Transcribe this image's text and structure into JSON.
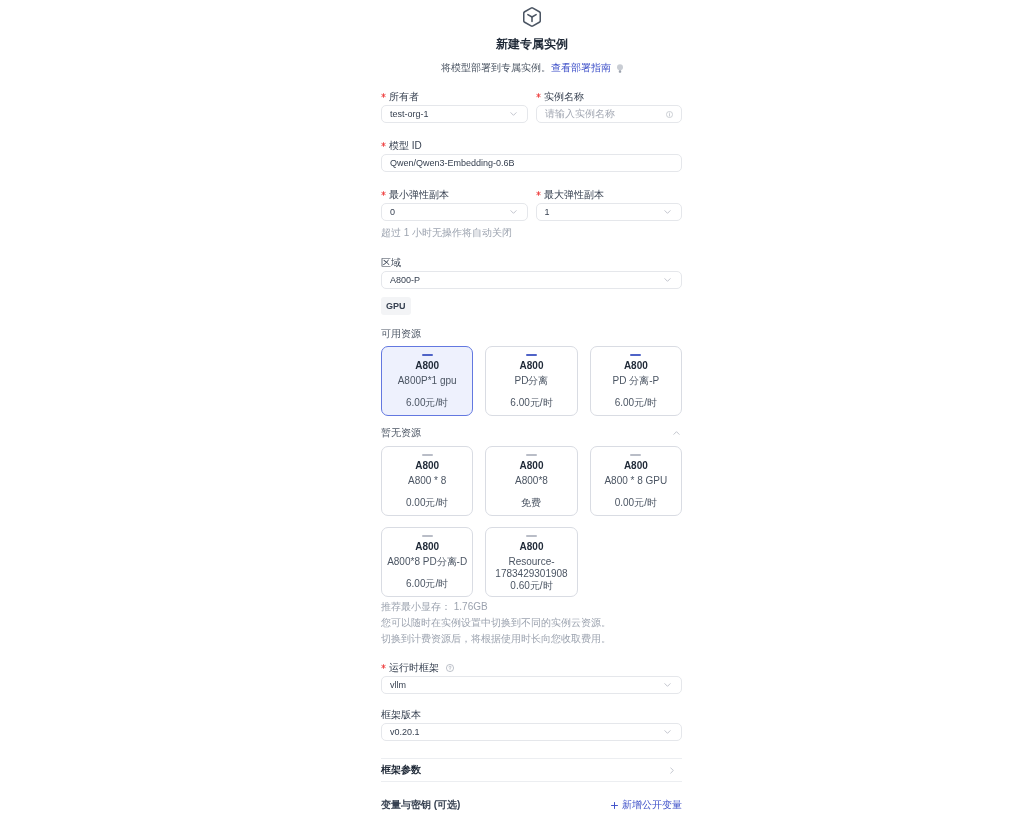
{
  "header": {
    "title": "新建专属实例",
    "subtitle": "将模型部署到专属实例。",
    "guide_link": "查看部署指南"
  },
  "owner": {
    "label": "所有者",
    "required": true,
    "kind": "select",
    "value": "test-org-1"
  },
  "instance_name": {
    "label": "实例名称",
    "required": true,
    "kind": "input",
    "placeholder": "请输入实例名称"
  },
  "model_id": {
    "label": "模型 ID",
    "required": true,
    "kind": "input",
    "value": "Qwen/Qwen3-Embedding-0.6B"
  },
  "min_replicas": {
    "label": "最小弹性副本",
    "required": true,
    "kind": "select",
    "value": "0"
  },
  "max_replicas": {
    "label": "最大弹性副本",
    "required": true,
    "kind": "select",
    "value": "1"
  },
  "replica_hint": "超过 1 小时无操作将自动关闭",
  "region": {
    "label": "区域",
    "required": false,
    "kind": "select",
    "value": "A800-P"
  },
  "resource_tabs": [
    {
      "label": "GPU",
      "selected": true
    }
  ],
  "available_resources": {
    "title": "可用资源",
    "cards": [
      {
        "title": "A800",
        "name": "A800P*1 gpu",
        "price": "6.00元/时",
        "selected": true,
        "disabled": false
      },
      {
        "title": "A800",
        "name": "PD分离",
        "price": "6.00元/时",
        "selected": false,
        "disabled": false
      },
      {
        "title": "A800",
        "name": "PD 分离-P",
        "price": "6.00元/时",
        "selected": false,
        "disabled": false
      }
    ]
  },
  "unavailable_resources": {
    "title": "暂无资源",
    "expanded": true,
    "cards": [
      {
        "title": "A800",
        "name": "A800 * 8",
        "price": "0.00元/时",
        "selected": false,
        "disabled": true
      },
      {
        "title": "A800",
        "name": "A800*8",
        "price": "免费",
        "selected": false,
        "disabled": true
      },
      {
        "title": "A800",
        "name": "A800 * 8 GPU",
        "price": "0.00元/时",
        "selected": false,
        "disabled": true
      },
      {
        "title": "A800",
        "name": "A800*8 PD分离-D",
        "price": "6.00元/时",
        "selected": false,
        "disabled": true
      },
      {
        "title": "A800",
        "name": "Resource-1783429301908",
        "price": "0.60元/时",
        "selected": false,
        "disabled": true
      }
    ]
  },
  "resource_notes": [
    "推荐最小显存： 1.76GB",
    "您可以随时在实例设置中切换到不同的实例云资源。",
    "切换到计费资源后，将根据使用时长向您收取费用。"
  ],
  "runtime_framework": {
    "label": "运行时框架",
    "required": true,
    "kind": "select",
    "value": "vllm"
  },
  "framework_version": {
    "label": "框架版本",
    "required": false,
    "kind": "select",
    "value": "v0.20.1"
  },
  "framework_params": {
    "label": "框架参数",
    "expanded": false
  },
  "variables": {
    "label": "变量与密钥 (可选)",
    "add_link": "新增公开变量"
  }
}
